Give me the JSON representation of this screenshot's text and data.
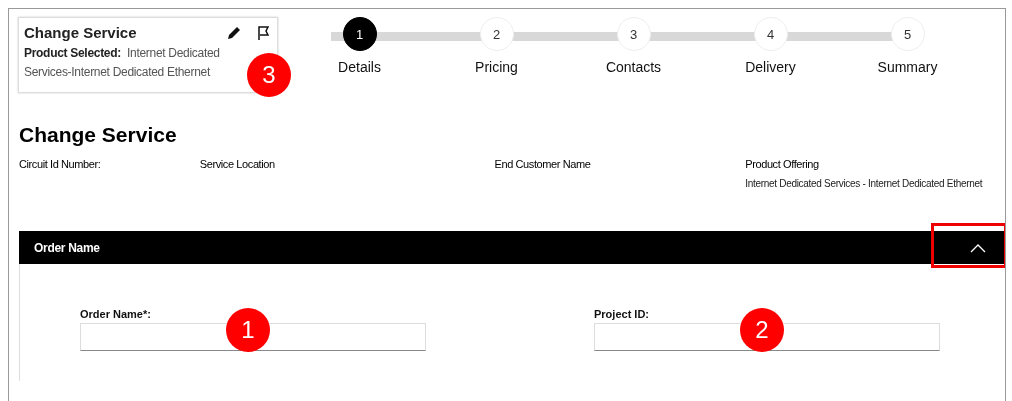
{
  "summary_card": {
    "title": "Change Service",
    "product_label": "Product Selected:",
    "product_value": "Internet Dedicated Services-Internet Dedicated Ethernet"
  },
  "steps": [
    {
      "number": "1",
      "label": "Details",
      "selected": true
    },
    {
      "number": "2",
      "label": "Pricing",
      "selected": false
    },
    {
      "number": "3",
      "label": "Contacts",
      "selected": false
    },
    {
      "number": "4",
      "label": "Delivery",
      "selected": false
    },
    {
      "number": "5",
      "label": "Summary",
      "selected": false
    }
  ],
  "page_title": "Change Service",
  "info_columns": [
    {
      "label": "Circuit Id Number:"
    },
    {
      "label": "Service Location"
    },
    {
      "label": "End Customer Name"
    },
    {
      "label": "Product Offering",
      "value": "Internet Dedicated Services - Internet Dedicated Ethernet"
    }
  ],
  "section": {
    "title": "Order Name",
    "expanded": true
  },
  "fields": [
    {
      "label": "Order Name*:"
    },
    {
      "label": "Project ID:"
    }
  ],
  "annotations": [
    {
      "label": "3"
    },
    {
      "label": "1"
    },
    {
      "label": "2"
    }
  ]
}
